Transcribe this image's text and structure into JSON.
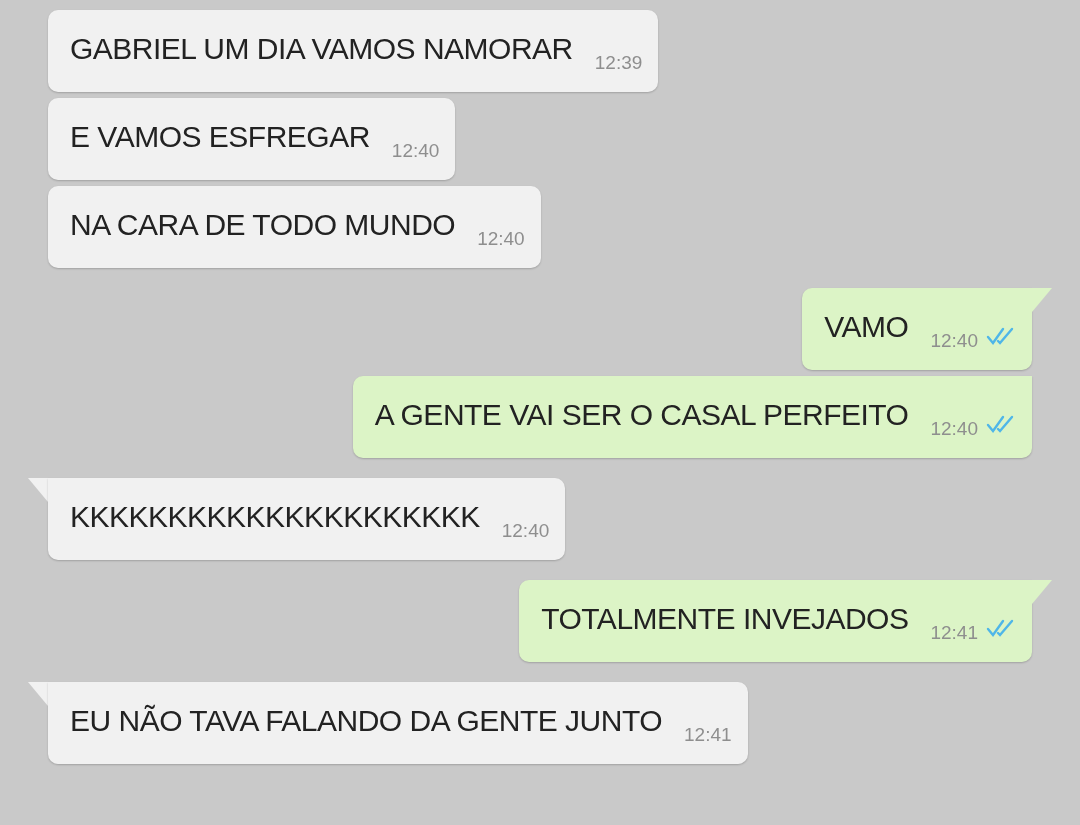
{
  "messages": [
    {
      "kind": "incoming",
      "text": "GABRIEL UM DIA VAMOS NAMORAR",
      "time": "12:39",
      "tail": false
    },
    {
      "kind": "incoming",
      "text": "E VAMOS ESFREGAR",
      "time": "12:40",
      "tail": false
    },
    {
      "kind": "incoming",
      "text": "NA CARA DE TODO MUNDO",
      "time": "12:40",
      "tail": false
    },
    {
      "kind": "outgoing",
      "text": "VAMO",
      "time": "12:40",
      "tail": true,
      "read": true
    },
    {
      "kind": "outgoing",
      "text": "A GENTE VAI SER O CASAL PERFEITO",
      "time": "12:40",
      "tail": false,
      "read": true
    },
    {
      "kind": "incoming",
      "text": "KKKKKKKKKKKKKKKKKKKKK",
      "time": "12:40",
      "tail": true
    },
    {
      "kind": "outgoing",
      "text": "TOTALMENTE INVEJADOS",
      "time": "12:41",
      "tail": true,
      "read": true
    },
    {
      "kind": "incoming",
      "text": "EU NÃO TAVA FALANDO DA GENTE JUNTO",
      "time": "12:41",
      "tail": true
    }
  ]
}
